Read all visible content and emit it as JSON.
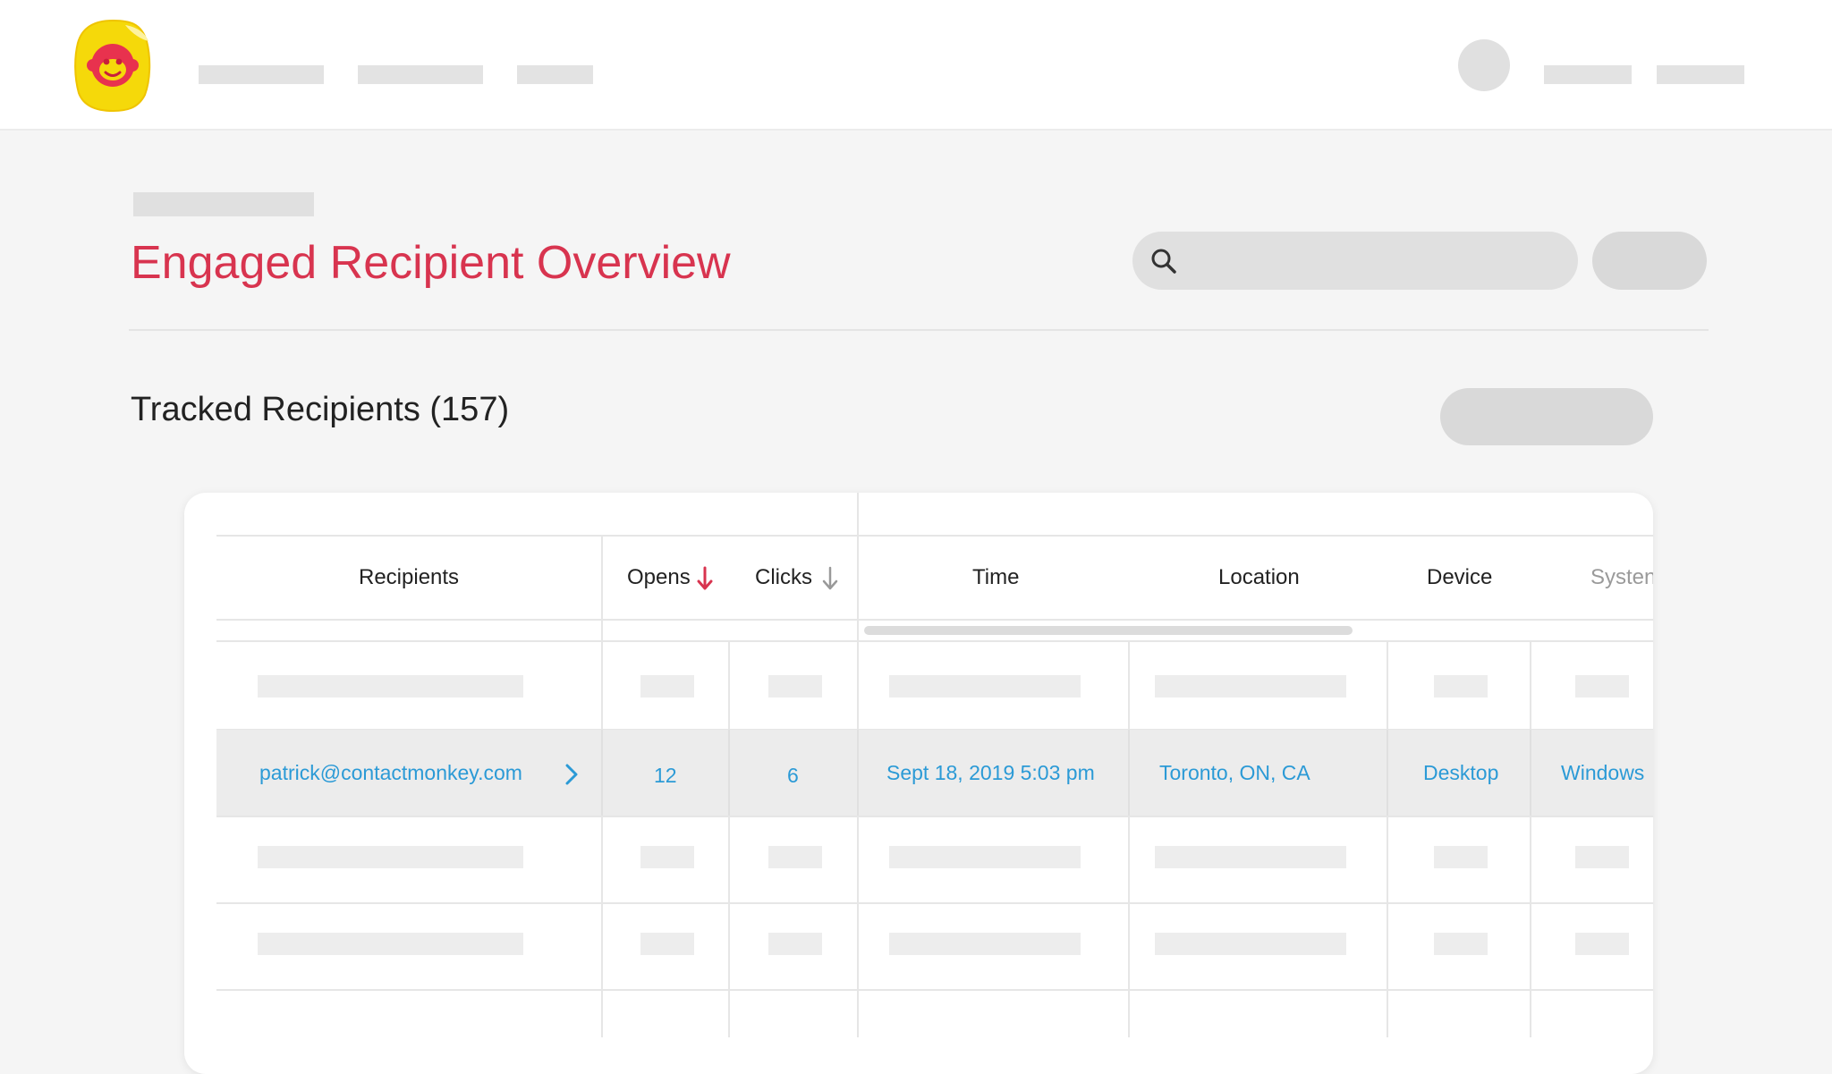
{
  "header": {
    "logo": "contactmonkey-monkey-logo"
  },
  "page": {
    "title": "Engaged Recipient Overview"
  },
  "search": {
    "icon": "search-icon"
  },
  "section": {
    "title": "Tracked Recipients (157)"
  },
  "table": {
    "columns": {
      "recipients": "Recipients",
      "opens": "Opens",
      "clicks": "Clicks",
      "time": "Time",
      "location": "Location",
      "device": "Device",
      "system": "Systen"
    },
    "highlighted_row": {
      "email": "patrick@contactmonkey.com",
      "opens": "12",
      "clicks": "6",
      "time": "Sept 18, 2019 5:03 pm",
      "location": "Toronto, ON, CA",
      "device": "Desktop",
      "system": "Windows"
    }
  },
  "colors": {
    "accent_red": "#d8344f",
    "link_blue": "#2b9ad6",
    "logo_yellow": "#f5d90a"
  }
}
